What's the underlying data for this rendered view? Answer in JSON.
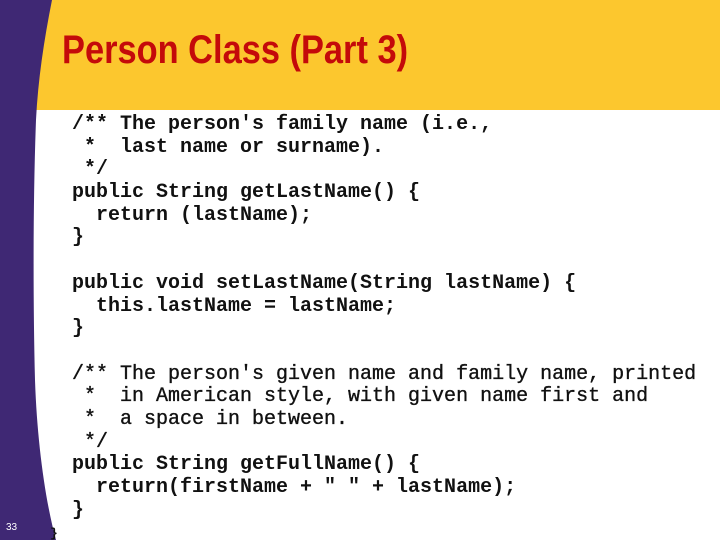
{
  "slide": {
    "title": "Person Class (Part 3)",
    "page_number": "33",
    "colors": {
      "header_background": "#fcc72e",
      "sidebar": "#3f2874",
      "title": "#c40a0a",
      "body_background": "#ffffff",
      "code_text": "#111111"
    }
  },
  "code": {
    "blocks": [
      {
        "lines": [
          "/** The person's family name (i.e.,",
          " *  last name or surname).",
          " */",
          "public String getLastName() {",
          "  return (lastName);",
          "}"
        ]
      },
      {
        "lines": [
          "public void setLastName(String lastName) {",
          "  this.lastName = lastName;",
          "}"
        ]
      },
      {
        "lines": [
          "/** The person's given name and family name, printed",
          " *  in American style, with given name first and",
          " *  a space in between.",
          " */",
          "public String getFullName() {",
          "  return(firstName + \" \" + lastName);",
          "}"
        ]
      }
    ]
  },
  "artifact_glyph": "}"
}
